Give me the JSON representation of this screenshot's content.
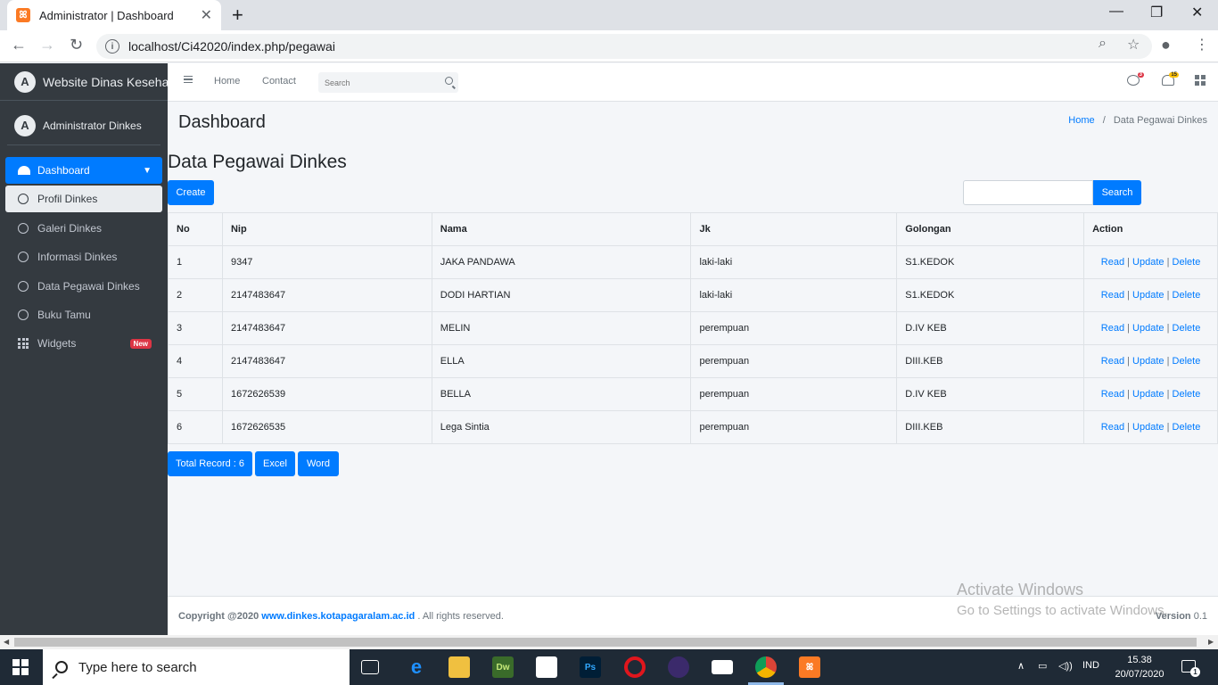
{
  "browser": {
    "tab_title": "Administrator | Dashboard",
    "url": "localhost/Ci42020/index.php/pegawai"
  },
  "sidebar": {
    "brand": "Website Dinas Kesehatan",
    "user": "Administrator Dinkes",
    "items": [
      {
        "label": "Dashboard"
      },
      {
        "label": "Profil Dinkes"
      },
      {
        "label": "Galeri Dinkes"
      },
      {
        "label": "Informasi Dinkes"
      },
      {
        "label": "Data Pegawai Dinkes"
      },
      {
        "label": "Buku Tamu"
      },
      {
        "label": "Widgets",
        "badge": "New"
      }
    ]
  },
  "topnav": {
    "home": "Home",
    "contact": "Contact",
    "search_placeholder": "Search",
    "chat_badge": "3",
    "bell_badge": "15"
  },
  "page": {
    "title": "Dashboard",
    "breadcrumb": {
      "home": "Home",
      "separator": "/",
      "current": "Data Pegawai Dinkes"
    },
    "section_title": "Data Pegawai Dinkes",
    "create_label": "Create",
    "search_label": "Search"
  },
  "table": {
    "headers": [
      "No",
      "Nip",
      "Nama",
      "Jk",
      "Golongan",
      "Action"
    ],
    "actions": {
      "read": "Read",
      "update": "Update",
      "delete": "Delete",
      "sep": "|"
    },
    "rows": [
      [
        "1",
        "9347",
        "JAKA PANDAWA",
        "laki-laki",
        "S1.KEDOK"
      ],
      [
        "2",
        "2147483647",
        "DODI HARTIAN",
        "laki-laki",
        "S1.KEDOK"
      ],
      [
        "3",
        "2147483647",
        "MELIN",
        "perempuan",
        "D.IV KEB"
      ],
      [
        "4",
        "2147483647",
        "ELLA",
        "perempuan",
        "DIII.KEB"
      ],
      [
        "5",
        "1672626539",
        "BELLA",
        "perempuan",
        "D.IV KEB"
      ],
      [
        "6",
        "1672626535",
        "Lega Sintia",
        "perempuan",
        "DIII.KEB"
      ]
    ]
  },
  "bottom_buttons": {
    "total": "Total Record : 6",
    "excel": "Excel",
    "word": "Word"
  },
  "footer": {
    "copyright": "Copyright @2020",
    "link": "www.dinkes.kotapagaralam.ac.id",
    "rights": ". All rights reserved.",
    "version_label": "Version",
    "version": "0.1"
  },
  "watermark": {
    "line1": "Activate Windows",
    "line2": "Go to Settings to activate Windows."
  },
  "taskbar": {
    "search": "Type here to search",
    "lang": "IND",
    "time": "15.38",
    "date": "20/07/2020",
    "notif_count": "1"
  },
  "colors": {
    "primary": "#007bff",
    "sidebar": "#343a40",
    "danger": "#dc3545"
  }
}
